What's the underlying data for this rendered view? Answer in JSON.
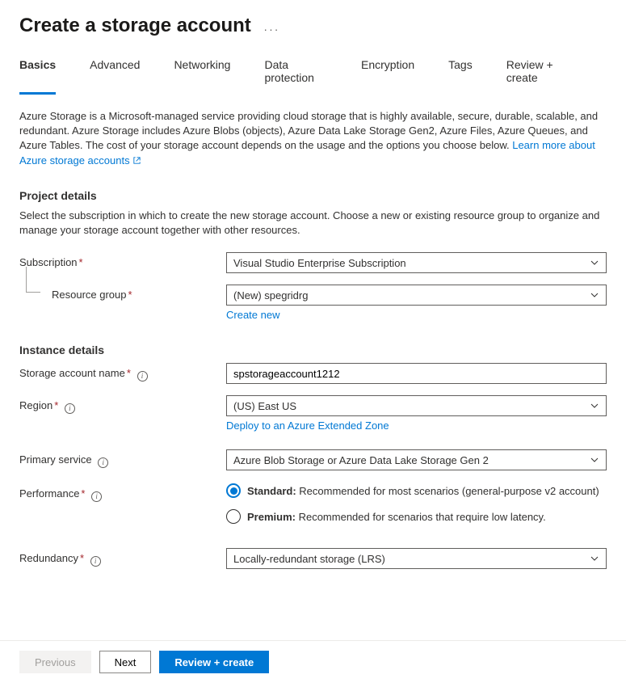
{
  "header": {
    "title": "Create a storage account",
    "more": "···"
  },
  "tabs": [
    "Basics",
    "Advanced",
    "Networking",
    "Data protection",
    "Encryption",
    "Tags",
    "Review + create"
  ],
  "active_tab": 0,
  "intro": {
    "text": "Azure Storage is a Microsoft-managed service providing cloud storage that is highly available, secure, durable, scalable, and redundant. Azure Storage includes Azure Blobs (objects), Azure Data Lake Storage Gen2, Azure Files, Azure Queues, and Azure Tables. The cost of your storage account depends on the usage and the options you choose below. ",
    "link": "Learn more about Azure storage accounts"
  },
  "project": {
    "title": "Project details",
    "desc": "Select the subscription in which to create the new storage account. Choose a new or existing resource group to organize and manage your storage account together with other resources.",
    "subscription_label": "Subscription",
    "subscription_value": "Visual Studio Enterprise Subscription",
    "rg_label": "Resource group",
    "rg_value": "(New) spegridrg",
    "rg_create": "Create new"
  },
  "instance": {
    "title": "Instance details",
    "name_label": "Storage account name",
    "name_value": "spstorageaccount1212",
    "region_label": "Region",
    "region_value": "(US) East US",
    "extended_link": "Deploy to an Azure Extended Zone",
    "service_label": "Primary service",
    "service_value": "Azure Blob Storage or Azure Data Lake Storage Gen 2",
    "perf_label": "Performance",
    "perf_standard_b": "Standard:",
    "perf_standard_t": " Recommended for most scenarios (general-purpose v2 account)",
    "perf_premium_b": "Premium:",
    "perf_premium_t": " Recommended for scenarios that require low latency.",
    "redundancy_label": "Redundancy",
    "redundancy_value": "Locally-redundant storage (LRS)"
  },
  "footer": {
    "prev": "Previous",
    "next": "Next",
    "review": "Review + create"
  }
}
